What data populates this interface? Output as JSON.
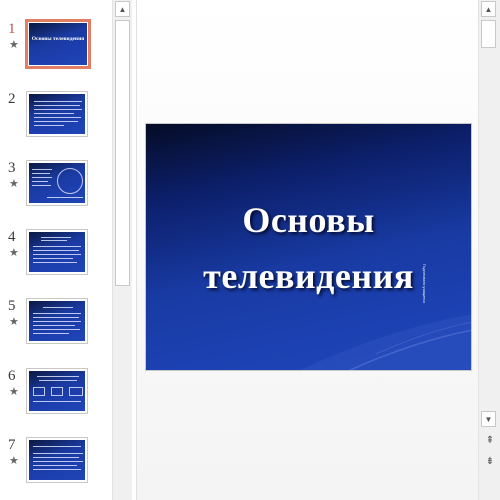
{
  "thumbnails": [
    {
      "number": "1",
      "starred": true,
      "active": true,
      "title": "Основы телевидения"
    },
    {
      "number": "2",
      "starred": false,
      "active": false
    },
    {
      "number": "3",
      "starred": true,
      "active": false
    },
    {
      "number": "4",
      "starred": true,
      "active": false
    },
    {
      "number": "5",
      "starred": true,
      "active": false
    },
    {
      "number": "6",
      "starred": true,
      "active": false
    },
    {
      "number": "7",
      "starred": true,
      "active": false
    }
  ],
  "star_glyph": "★",
  "main_slide": {
    "title_line1": "Основы",
    "title_line2": "телевидения",
    "subtitle": "Подготовили учащиеся"
  },
  "scroll": {
    "up_glyph": "▲",
    "down_glyph": "▼",
    "prev_slide_glyph": "⇞",
    "next_slide_glyph": "⇟"
  },
  "colors": {
    "slide_background": "#1c41b2",
    "active_thumbnail_border": "#e07f63",
    "active_number": "#c0504d"
  }
}
